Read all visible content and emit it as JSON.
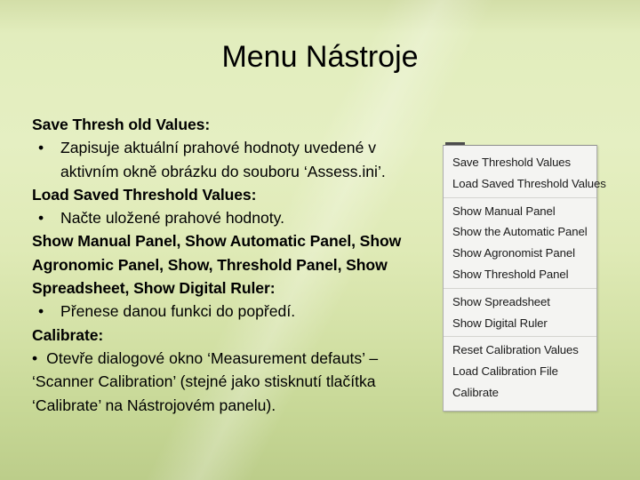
{
  "slide": {
    "title": "Menu Nástroje",
    "background_top_color": "#e5efc2",
    "background_bottom_color": "#bccd8a",
    "text_color": "#000000"
  },
  "body": {
    "blocks": [
      {
        "kind": "heading",
        "text": "Save Thresh old Values:"
      },
      {
        "kind": "bullet",
        "marker": "•",
        "text": "Zapisuje aktuální prahové hodnoty uvedené v aktivním okně obrázku do souboru ‘Assess.ini’."
      },
      {
        "kind": "heading",
        "text": "Load Saved Threshold Values:"
      },
      {
        "kind": "bullet",
        "marker": "•",
        "text": "Načte uložené prahové hodnoty."
      },
      {
        "kind": "heading",
        "text": "Show Manual Panel, Show Automatic Panel, Show Agronomic Panel, Show, Threshold Panel, Show Spreadsheet, Show Digital Ruler:"
      },
      {
        "kind": "bullet",
        "marker": "•",
        "text": "Přenese danou funkci do popředí."
      },
      {
        "kind": "heading",
        "text": "Calibrate:"
      },
      {
        "kind": "bullet-flat",
        "marker": "•",
        "text": "Otevře dialogové okno ‘Measurement defauts’ – ‘Scanner Calibration’ (stejné jako stisknutí tlačítka ‘Calibrate’ na Nástrojovém panelu)."
      }
    ]
  },
  "menu": {
    "name": "tools-menu",
    "groups": [
      {
        "items": [
          {
            "label": "Save Threshold Values"
          },
          {
            "label": "Load Saved Threshold Values"
          }
        ]
      },
      {
        "items": [
          {
            "label": "Show Manual Panel"
          },
          {
            "label": "Show the Automatic Panel"
          },
          {
            "label": "Show Agronomist Panel"
          },
          {
            "label": "Show Threshold Panel"
          }
        ]
      },
      {
        "items": [
          {
            "label": "Show Spreadsheet"
          },
          {
            "label": "Show Digital Ruler"
          }
        ]
      },
      {
        "items": [
          {
            "label": "Reset Calibration Values"
          },
          {
            "label": "Load Calibration File"
          },
          {
            "label": "Calibrate"
          }
        ]
      }
    ]
  }
}
